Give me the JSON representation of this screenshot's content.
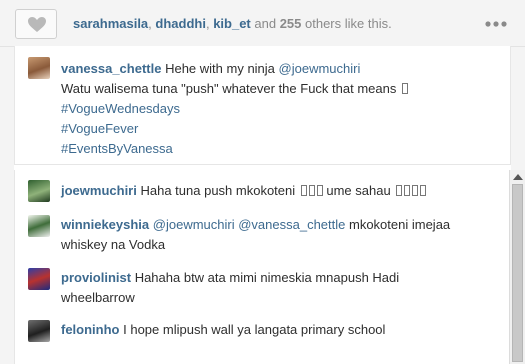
{
  "likes": {
    "users": [
      "sarahmasila",
      "dhaddhi",
      "kib_et"
    ],
    "sep1": ", ",
    "sep2": ", ",
    "and_text": " and ",
    "others_count": "255",
    "others_text": " others like this."
  },
  "caption": {
    "username": "vanessa_chettle",
    "text_pre": "Hehe with my ninja ",
    "mention": "@joewmuchiri",
    "line2": "Watu walisema tuna \"push\" whatever the Fuck that means",
    "hashtags": [
      "#VogueWednesdays",
      "#VogueFever",
      "#EventsByVanessa"
    ]
  },
  "comments": [
    {
      "username": "joewmuchiri",
      "text": "Haha tuna push mkokoteni",
      "line2": ""
    },
    {
      "username": "winniekeyshia",
      "mention1": "@joewmuchiri",
      "mention2": "@vanessa_chettle",
      "text": " mkokoteni imejaa",
      "line2": "whiskey na Vodka"
    },
    {
      "username": "proviolinist",
      "text": "Hahaha btw ata mimi nimeskia mnapush Hadi",
      "line2": "wheelbarrow"
    },
    {
      "username": "feloninho",
      "text": "I hope mlipush wall ya langata primary school",
      "line2": ""
    }
  ],
  "colors": {
    "link": "#3d6a8f",
    "text": "#2e2e2e",
    "muted": "#8a8a8a"
  },
  "icons": {
    "like": "heart-icon",
    "more": "ellipsis-icon"
  }
}
